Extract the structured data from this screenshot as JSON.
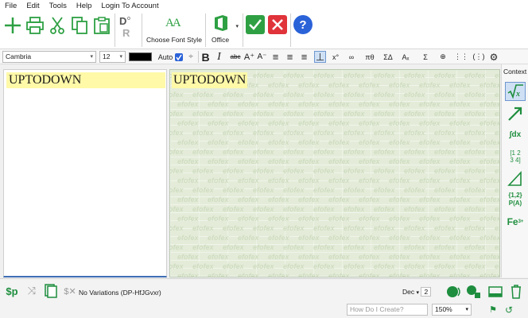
{
  "menu": [
    "File",
    "Edit",
    "Tools",
    "Help",
    "Login To Account"
  ],
  "ribbon": {
    "choose_font_style": "Choose Font Style",
    "office": "Office",
    "font_icon_text": "AA"
  },
  "format": {
    "font": "Cambria",
    "size": "12",
    "color_auto": "Auto",
    "bold": "B",
    "italic": "I",
    "strike": "abc"
  },
  "editor": {
    "text": "UPTODOWN"
  },
  "preview": {
    "text": "UPTODOWN",
    "watermark": "efofex"
  },
  "context": {
    "title": "Context",
    "set_label": "{1,2}",
    "prob_label": "P(A)",
    "chem_label": "Fe"
  },
  "bottom": {
    "no_variations": "No Variations (DP-HfJGvxr)",
    "decimal": "Dec",
    "decimal_places": "2",
    "help_placeholder": "How Do I Create?",
    "zoom": "150%",
    "dollar_p": "$p"
  },
  "colors": {
    "green": "#2ea043",
    "red": "#e0333a",
    "blue": "#2a62d8",
    "highlight": "#fff9a8",
    "accent": "#1e8e3e"
  }
}
